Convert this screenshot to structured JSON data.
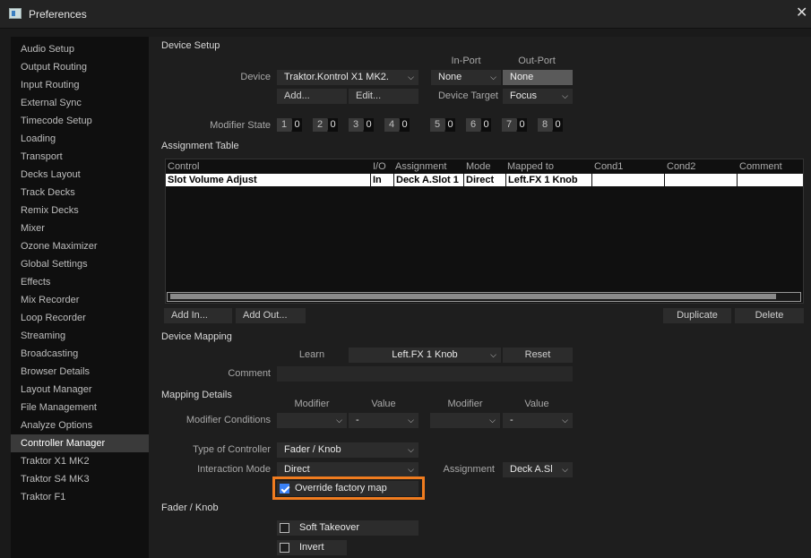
{
  "window": {
    "title": "Preferences"
  },
  "sidebar": {
    "items": [
      "Audio Setup",
      "Output Routing",
      "Input Routing",
      "External Sync",
      "Timecode Setup",
      "Loading",
      "Transport",
      "Decks Layout",
      "Track Decks",
      "Remix Decks",
      "Mixer",
      "Ozone Maximizer",
      "Global Settings",
      "Effects",
      "Mix Recorder",
      "Loop Recorder",
      "Streaming",
      "Broadcasting",
      "Browser Details",
      "Layout Manager",
      "File Management",
      "Analyze Options",
      "Controller Manager",
      "Traktor X1 MK2",
      "Traktor S4 MK3",
      "Traktor F1"
    ],
    "selected": "Controller Manager"
  },
  "device_setup": {
    "heading": "Device Setup",
    "device_label": "Device",
    "device_value": "Traktor.Kontrol X1 MK2.",
    "in_port_label": "In-Port",
    "out_port_label": "Out-Port",
    "in_port_value": "None",
    "out_port_value": "None",
    "add_button": "Add...",
    "edit_button": "Edit...",
    "device_target_label": "Device Target",
    "device_target_value": "Focus",
    "modifier_state_label": "Modifier State",
    "modifiers": [
      {
        "n": "1",
        "v": "0"
      },
      {
        "n": "2",
        "v": "0"
      },
      {
        "n": "3",
        "v": "0"
      },
      {
        "n": "4",
        "v": "0"
      },
      {
        "n": "5",
        "v": "0"
      },
      {
        "n": "6",
        "v": "0"
      },
      {
        "n": "7",
        "v": "0"
      },
      {
        "n": "8",
        "v": "0"
      }
    ]
  },
  "assignment_table": {
    "heading": "Assignment Table",
    "columns": [
      "Control",
      "I/O",
      "Assignment",
      "Mode",
      "Mapped to",
      "Cond1",
      "Cond2",
      "Comment"
    ],
    "rows": [
      [
        "Slot Volume Adjust",
        "In",
        "Deck A.Slot 1",
        "Direct",
        "Left.FX 1 Knob",
        "",
        "",
        ""
      ]
    ],
    "add_in": "Add In...",
    "add_out": "Add Out...",
    "duplicate": "Duplicate",
    "delete": "Delete"
  },
  "device_mapping": {
    "heading": "Device Mapping",
    "learn_label": "Learn",
    "learn_value": "Left.FX 1 Knob",
    "reset_button": "Reset",
    "comment_label": "Comment",
    "comment_value": ""
  },
  "mapping_details": {
    "heading": "Mapping Details",
    "modifier_header_1": "Modifier",
    "value_header_1": "Value",
    "modifier_header_2": "Modifier",
    "value_header_2": "Value",
    "modifier_conditions_label": "Modifier Conditions",
    "cond1_modifier": "",
    "cond1_value": "-",
    "cond2_modifier": "",
    "cond2_value": "-",
    "type_of_controller_label": "Type of Controller",
    "type_of_controller_value": "Fader / Knob",
    "interaction_mode_label": "Interaction Mode",
    "interaction_mode_value": "Direct",
    "assignment_label": "Assignment",
    "assignment_value": "Deck A.Sl",
    "override_label": "Override factory map",
    "override_checked": true
  },
  "fader_knob": {
    "heading": "Fader / Knob",
    "soft_takeover_label": "Soft Takeover",
    "soft_takeover_checked": false,
    "invert_label": "Invert",
    "invert_checked": false
  },
  "colors": {
    "highlight": "#f07c1f",
    "checkbox": "#3b82f6"
  }
}
